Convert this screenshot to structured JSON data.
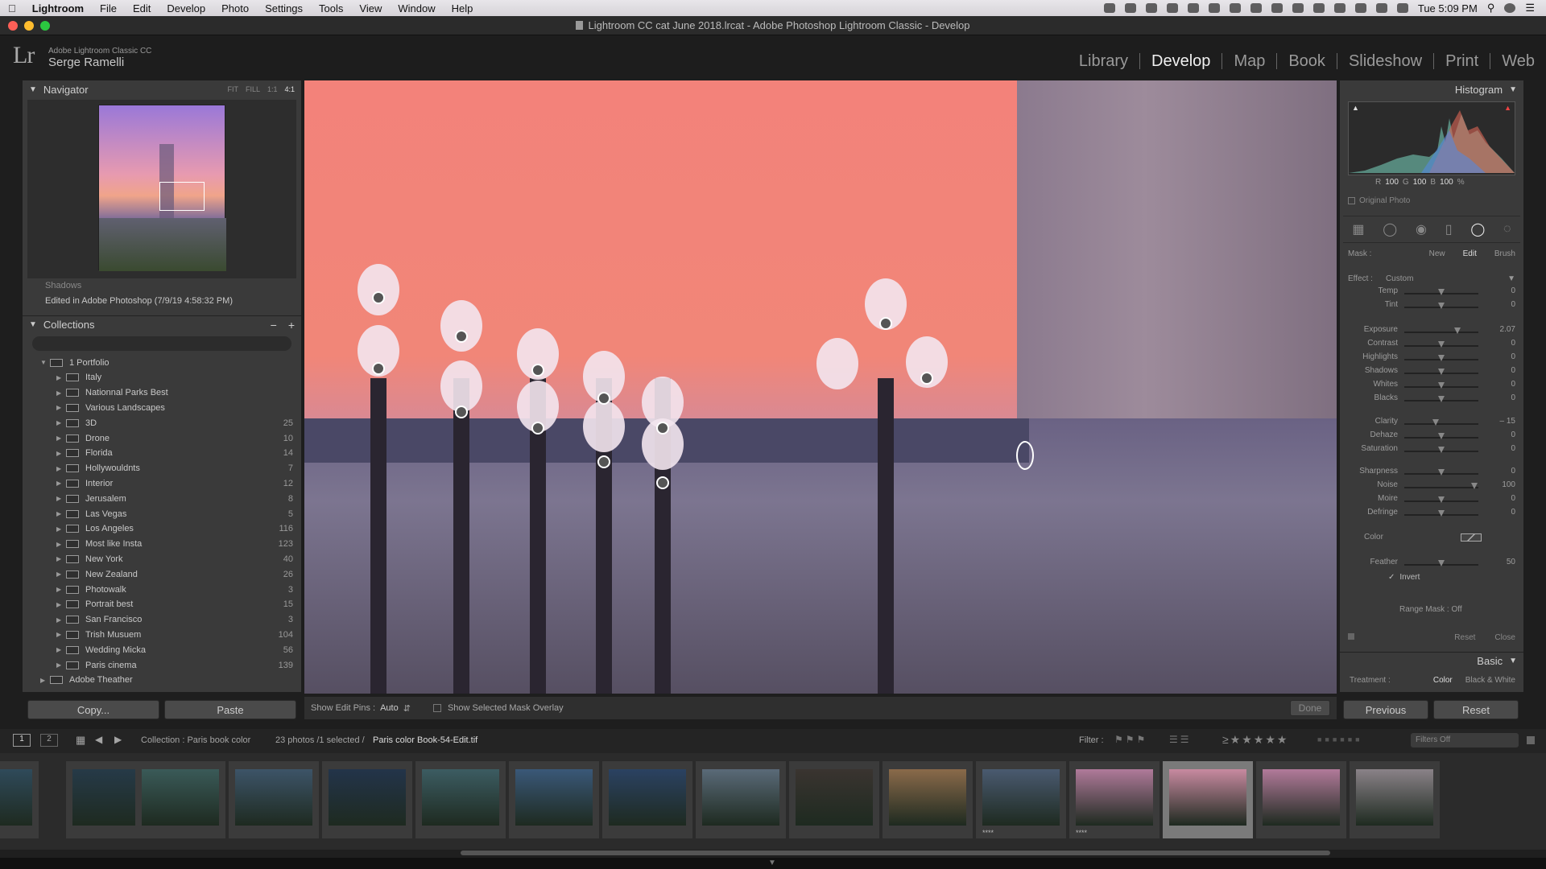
{
  "menubar": {
    "apple": "",
    "items": [
      "Lightroom",
      "File",
      "Edit",
      "Develop",
      "Photo",
      "Settings",
      "Tools",
      "View",
      "Window",
      "Help"
    ],
    "clock": "Tue 5:09 PM"
  },
  "window": {
    "title": "Lightroom CC cat June 2018.lrcat - Adobe Photoshop Lightroom Classic - Develop"
  },
  "identity": {
    "logo": "Lr",
    "product": "Adobe Lightroom Classic CC",
    "user": "Serge Ramelli"
  },
  "modules": [
    "Library",
    "Develop",
    "Map",
    "Book",
    "Slideshow",
    "Print",
    "Web"
  ],
  "active_module": "Develop",
  "navigator": {
    "title": "Navigator",
    "zoom_options": [
      "FIT",
      "FILL",
      "1:1",
      "4:1"
    ]
  },
  "history": {
    "item_partial": "Shadows",
    "item": "Edited in Adobe Photoshop (7/9/19 4:58:32 PM)"
  },
  "collections": {
    "title": "Collections",
    "items": [
      {
        "name": "1 Portfolio",
        "count": ""
      },
      {
        "name": "Italy",
        "count": ""
      },
      {
        "name": "Nationnal Parks Best",
        "count": ""
      },
      {
        "name": "Various Landscapes",
        "count": ""
      },
      {
        "name": "3D",
        "count": "25"
      },
      {
        "name": "Drone",
        "count": "10"
      },
      {
        "name": "Florida",
        "count": "14"
      },
      {
        "name": "Hollywouldnts",
        "count": "7"
      },
      {
        "name": "Interior",
        "count": "12"
      },
      {
        "name": "Jerusalem",
        "count": "8"
      },
      {
        "name": "Las Vegas",
        "count": "5"
      },
      {
        "name": "Los Angeles",
        "count": "116"
      },
      {
        "name": "Most like Insta",
        "count": "123"
      },
      {
        "name": "New York",
        "count": "40"
      },
      {
        "name": "New Zealand",
        "count": "26"
      },
      {
        "name": "Photowalk",
        "count": "3"
      },
      {
        "name": "Portrait best",
        "count": "15"
      },
      {
        "name": "San Francisco",
        "count": "3"
      },
      {
        "name": "Trish Musuem",
        "count": "104"
      },
      {
        "name": "Wedding Micka",
        "count": "56"
      },
      {
        "name": "Paris cinema",
        "count": "139"
      },
      {
        "name": "Adobe Theather",
        "count": ""
      }
    ]
  },
  "left_buttons": {
    "copy": "Copy...",
    "paste": "Paste"
  },
  "toolbar": {
    "show_pins_label": "Show Edit Pins :",
    "show_pins_value": "Auto",
    "overlay_label": "Show Selected Mask Overlay",
    "done": "Done"
  },
  "histogram": {
    "title": "Histogram",
    "r_label": "R",
    "r": "100",
    "g_label": "G",
    "g": "100",
    "b_label": "B",
    "b": "100",
    "pct": "%",
    "original": "Original Photo"
  },
  "mask": {
    "label": "Mask :",
    "new": "New",
    "edit": "Edit",
    "brush": "Brush",
    "effect_label": "Effect :",
    "effect_value": "Custom"
  },
  "sliders": [
    {
      "label": "Temp",
      "value": "0",
      "pos": 0.5
    },
    {
      "label": "Tint",
      "value": "0",
      "pos": 0.5
    },
    {
      "label": "Exposure",
      "value": "2.07",
      "pos": 0.72
    },
    {
      "label": "Contrast",
      "value": "0",
      "pos": 0.5
    },
    {
      "label": "Highlights",
      "value": "0",
      "pos": 0.5
    },
    {
      "label": "Shadows",
      "value": "0",
      "pos": 0.5
    },
    {
      "label": "Whites",
      "value": "0",
      "pos": 0.5
    },
    {
      "label": "Blacks",
      "value": "0",
      "pos": 0.5
    },
    {
      "label": "Clarity",
      "value": "– 15",
      "pos": 0.42
    },
    {
      "label": "Dehaze",
      "value": "0",
      "pos": 0.5
    },
    {
      "label": "Saturation",
      "value": "0",
      "pos": 0.5
    },
    {
      "label": "Sharpness",
      "value": "0",
      "pos": 0.5
    },
    {
      "label": "Noise",
      "value": "100",
      "pos": 0.95
    },
    {
      "label": "Moire",
      "value": "0",
      "pos": 0.5
    },
    {
      "label": "Defringe",
      "value": "0",
      "pos": 0.5
    }
  ],
  "color_label": "Color",
  "feather": {
    "label": "Feather",
    "value": "50",
    "pos": 0.5
  },
  "invert": "Invert",
  "range_mask": "Range Mask : Off",
  "mask_footer": {
    "reset": "Reset",
    "close": "Close"
  },
  "basic": {
    "title": "Basic",
    "treatment": "Treatment :",
    "color": "Color",
    "bw": "Black & White"
  },
  "right_buttons": {
    "previous": "Previous",
    "reset": "Reset"
  },
  "filmbar": {
    "page1": "1",
    "page2": "2",
    "collection": "Collection : Paris book color",
    "count": "23 photos /1 selected /",
    "file": "Paris color Book-54-Edit.tif",
    "filter_label": "Filter :",
    "filters_off": "Filters Off"
  },
  "filmstrip_stars": [
    "",
    "",
    "",
    "",
    "",
    "",
    "",
    "",
    "",
    "",
    "",
    "****",
    "****",
    "",
    "",
    ""
  ],
  "colors": {
    "accent": "#f1f1f1",
    "panel": "#3a3a3a",
    "sky": "#f3827a"
  }
}
